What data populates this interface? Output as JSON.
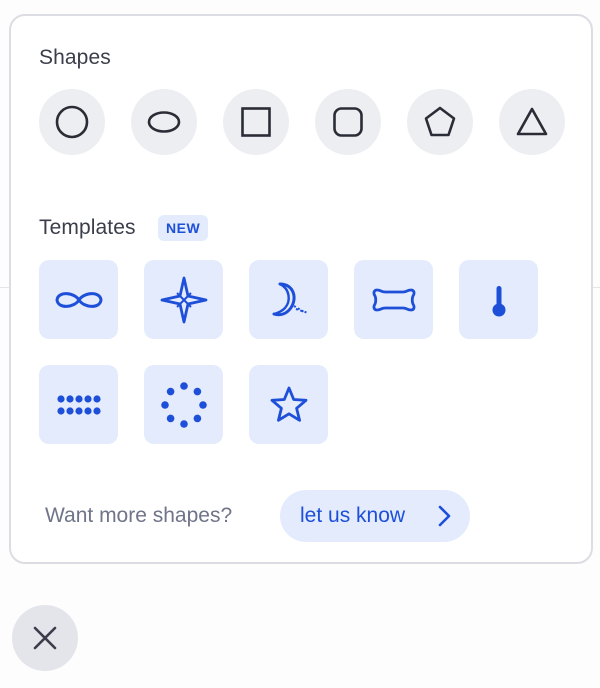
{
  "shapes": {
    "title": "Shapes",
    "items": [
      {
        "name": "circle"
      },
      {
        "name": "ellipse"
      },
      {
        "name": "square"
      },
      {
        "name": "rounded-square"
      },
      {
        "name": "pentagon"
      },
      {
        "name": "triangle"
      }
    ]
  },
  "templates": {
    "title": "Templates",
    "badge": "NEW",
    "items": [
      {
        "name": "infinity-template"
      },
      {
        "name": "four-point-star-template"
      },
      {
        "name": "crescent-moon-template"
      },
      {
        "name": "bone-banner-template"
      },
      {
        "name": "thermometer-template"
      },
      {
        "name": "dot-grid-template"
      },
      {
        "name": "dot-ring-template"
      },
      {
        "name": "star-template"
      }
    ]
  },
  "footer": {
    "text": "Want more shapes?",
    "button_label": "let us know"
  },
  "colors": {
    "accent": "#1d4fd8",
    "tile_bg": "#e3ebfd",
    "shape_bg": "#edeef2",
    "icon_dark": "#2a2d36"
  }
}
